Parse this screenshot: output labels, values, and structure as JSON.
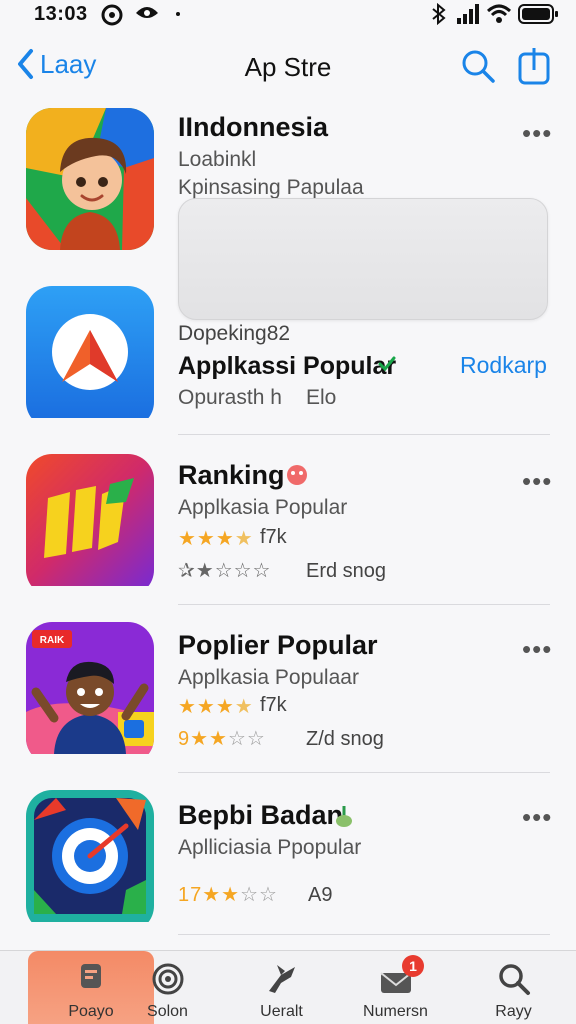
{
  "status_bar": {
    "time": "13:03"
  },
  "nav": {
    "back_label": "Laay",
    "title": "Ap Stre"
  },
  "apps": [
    {
      "title": "IIndonnesia",
      "line1": "Loabinkl",
      "line2": "Kpinsasing Papulaa"
    },
    {
      "line1": "Dopeking82",
      "title": "Applkassi Popular",
      "meta": "Opurasth h",
      "meta2": "Elo",
      "action": "Rodkarp"
    },
    {
      "title": "Ranking",
      "sub": "Applkasia Popular",
      "rating_text": "f7k",
      "rank_text": "Erd snog"
    },
    {
      "title": "Poplier Popular",
      "sub": "Applkasia Populaar",
      "rating_text": "f7k",
      "rank_prefix": "9",
      "rank_text": "Z/d snog",
      "badge_text": "RAIK"
    },
    {
      "title": "Bepbi Badan",
      "sub": "Aplliciasia Ppopular",
      "rank_prefix": "17",
      "rank_text": "A9"
    }
  ],
  "tabs": [
    {
      "label": "Poayo",
      "active": true
    },
    {
      "label": "Solon"
    },
    {
      "label": "Ueralt"
    },
    {
      "label": "Numersn",
      "badge": "1"
    },
    {
      "label": "Rayy"
    }
  ],
  "colors": {
    "accent": "#1a84e8",
    "star": "#f5a623",
    "badge": "#e83b2f",
    "active_tab": "#f48a66"
  }
}
